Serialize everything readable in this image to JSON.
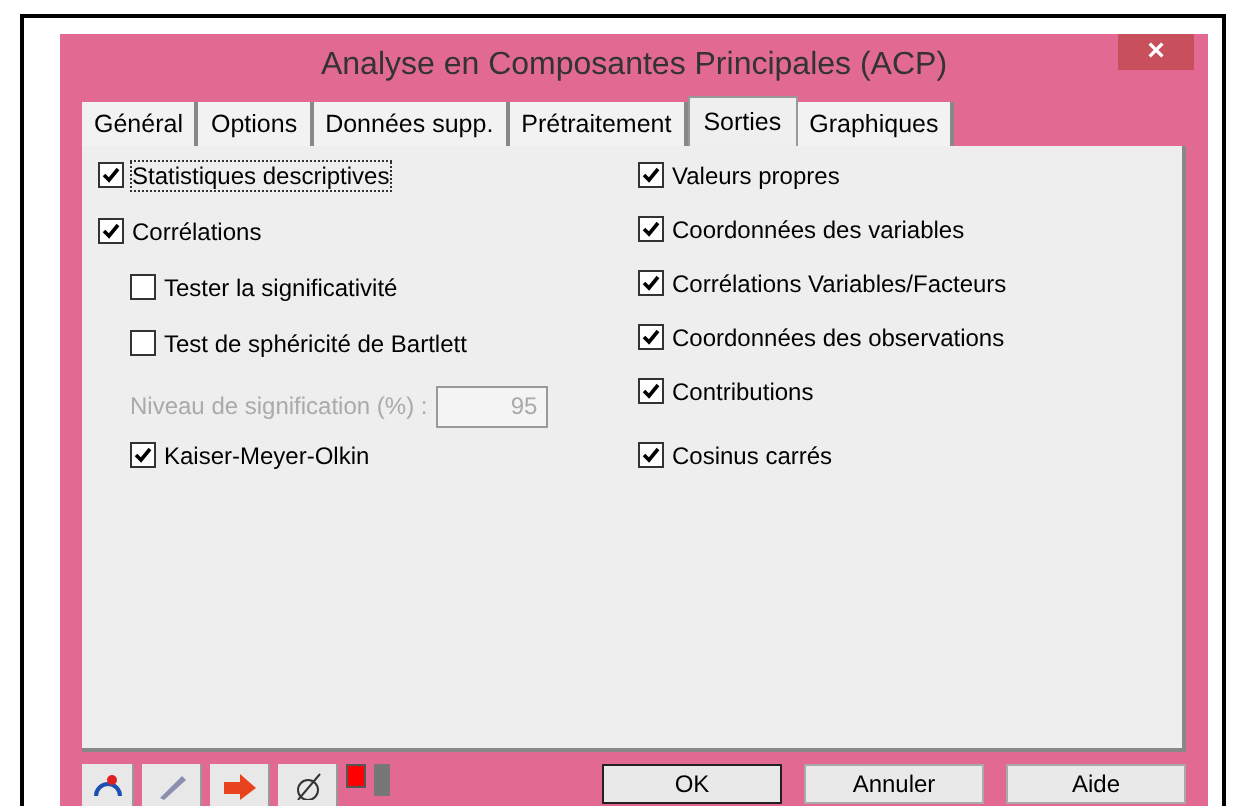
{
  "window": {
    "title": "Analyse en Composantes Principales (ACP)",
    "close": "×"
  },
  "tabs": [
    {
      "label": "Général",
      "selected": false
    },
    {
      "label": "Options",
      "selected": false
    },
    {
      "label": "Données supp.",
      "selected": false
    },
    {
      "label": "Prétraitement",
      "selected": false
    },
    {
      "label": "Sorties",
      "selected": true
    },
    {
      "label": "Graphiques",
      "selected": false
    }
  ],
  "left_options": [
    {
      "kind": "checkbox",
      "label": "Statistiques descriptives",
      "checked": true,
      "focused": true,
      "indented": false
    },
    {
      "kind": "checkbox",
      "label": "Corrélations",
      "checked": true,
      "focused": false,
      "indented": false
    },
    {
      "kind": "checkbox",
      "label": "Tester la significativité",
      "checked": false,
      "focused": false,
      "indented": true
    },
    {
      "kind": "checkbox",
      "label": "Test de sphéricité de Bartlett",
      "checked": false,
      "focused": false,
      "indented": true
    },
    {
      "kind": "field",
      "label": "Niveau de signification (%) :",
      "value": "95",
      "disabled": true,
      "indented": true
    },
    {
      "kind": "checkbox",
      "label": "Kaiser-Meyer-Olkin",
      "checked": true,
      "focused": false,
      "indented": true
    }
  ],
  "right_options": [
    {
      "label": "Valeurs propres",
      "checked": true
    },
    {
      "label": "Coordonnées des variables",
      "checked": true
    },
    {
      "label": "Corrélations Variables/Facteurs",
      "checked": true
    },
    {
      "label": "Coordonnées des observations",
      "checked": true
    },
    {
      "label": "Contributions",
      "checked": true
    },
    {
      "label": "Cosinus carrés",
      "checked": true
    }
  ],
  "buttons": [
    "OK",
    "Annuler",
    "Aide"
  ]
}
